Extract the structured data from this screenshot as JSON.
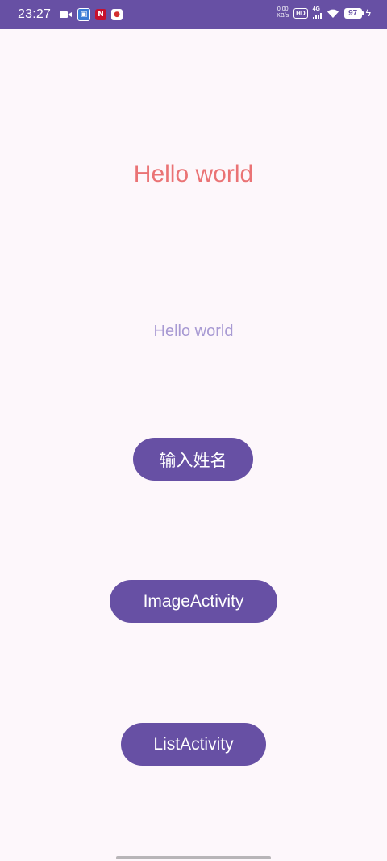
{
  "status_bar": {
    "time": "23:27",
    "net_speed_value": "0.00",
    "net_speed_unit": "KB/s",
    "hd_label": "HD",
    "network_type": "4G",
    "battery": "97",
    "bar_color": "#6750a4"
  },
  "main": {
    "title": "Hello world",
    "subtitle": "Hello world",
    "buttons": {
      "enter_name": "输入姓名",
      "image_activity": "ImageActivity",
      "list_activity": "ListActivity"
    }
  },
  "colors": {
    "background": "#fdf7fb",
    "title": "#ea7375",
    "subtitle": "#a89ad3",
    "button": "#6750a4"
  }
}
